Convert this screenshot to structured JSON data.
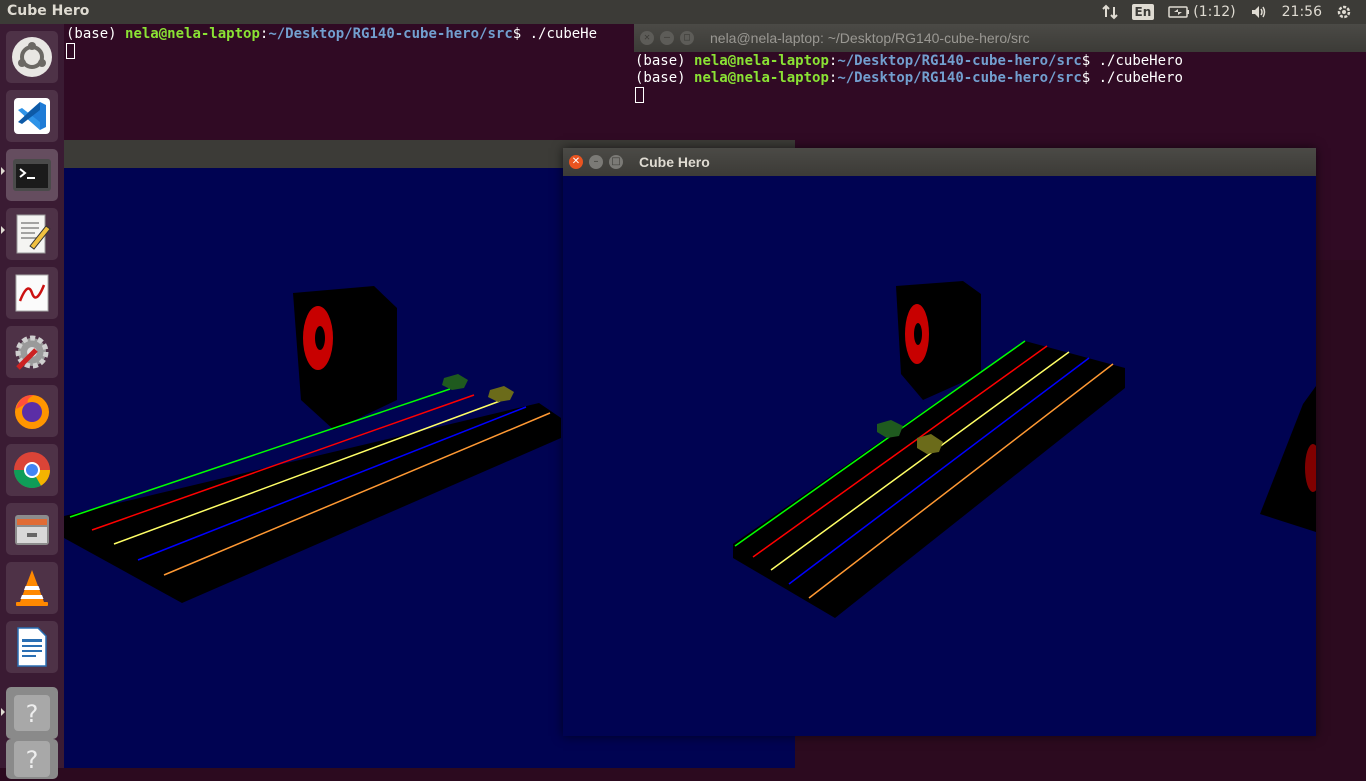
{
  "topbar": {
    "app_title": "Cube Hero",
    "keyboard_layout": "En",
    "battery_text": "(1:12)",
    "clock": "21:56"
  },
  "launcher": {
    "items": [
      {
        "name": "ubuntu-dash-icon"
      },
      {
        "name": "vscode-icon"
      },
      {
        "name": "terminal-icon"
      },
      {
        "name": "text-editor-icon"
      },
      {
        "name": "pdf-viewer-icon"
      },
      {
        "name": "system-settings-icon"
      },
      {
        "name": "firefox-icon"
      },
      {
        "name": "chrome-icon"
      },
      {
        "name": "file-manager-icon"
      },
      {
        "name": "vlc-icon"
      },
      {
        "name": "libreoffice-writer-icon"
      },
      {
        "name": "unknown-app-icon"
      },
      {
        "name": "unknown-app-icon"
      }
    ]
  },
  "terminal1": {
    "prompt_prefix": "(base) ",
    "user_host": "nela@nela-laptop",
    "colon": ":",
    "path": "~/Desktop/RG140-cube-hero/src",
    "dollar": "$ ",
    "command": "./cubeHe"
  },
  "terminal2": {
    "title": "nela@nela-laptop: ~/Desktop/RG140-cube-hero/src",
    "lines": [
      {
        "prefix": "(base) ",
        "user_host": "nela@nela-laptop",
        "colon": ":",
        "path": "~/Desktop/RG140-cube-hero/src",
        "dollar": "$ ",
        "command": "./cubeHero"
      },
      {
        "prefix": "(base) ",
        "user_host": "nela@nela-laptop",
        "colon": ":",
        "path": "~/Desktop/RG140-cube-hero/src",
        "dollar": "$ ",
        "command": "./cubeHero"
      }
    ]
  },
  "game_window": {
    "title": "Cube Hero"
  },
  "colors": {
    "desktop_bg": "#2c0a1f",
    "terminal_bg": "#300a24",
    "gl_bg": "#000352",
    "lane_green": "#00ff00",
    "lane_red": "#ff0000",
    "lane_yellow": "#ffff66",
    "lane_blue": "#0000ff",
    "lane_orange": "#ff9933",
    "accent": "#e95420"
  }
}
